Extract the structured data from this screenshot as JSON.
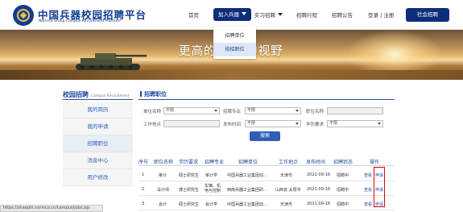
{
  "header": {
    "brand_title": "中国兵器校园招聘平台",
    "brand_subtitle": "Norinco Group Campus Recruitment Platform",
    "nav": {
      "home": "首页",
      "join": "加入兵器",
      "intern": "实习招聘",
      "schedule": "招聘行程",
      "notice": "招聘公告",
      "login_register": "登录 | 注册",
      "social": "社会招聘"
    },
    "dropdown": [
      "招聘单位",
      "校招职位"
    ]
  },
  "hero": {
    "slogan": "更高的 更大的视野"
  },
  "sidebar": {
    "title": "校园招聘",
    "title_en": "Campus Recruitment",
    "items": [
      "我的简历",
      "我的申请",
      "招聘职位",
      "消息中心",
      "用户修改"
    ]
  },
  "main": {
    "title": "招聘职位",
    "filters": {
      "unit_label": "单位名称",
      "unit_value": "不限",
      "major_label": "招聘专业",
      "major_value": "不限",
      "position_label": "职位名称",
      "position_value": "",
      "location_label": "工作地点",
      "location_value": "",
      "time_label": "发布时间",
      "time_value": "不限",
      "degree_label": "学历要求",
      "degree_value": "不限",
      "search_label": "搜索"
    },
    "table": {
      "headers": [
        "序号",
        "职位名称",
        "学历要求",
        "招聘专业",
        "招聘单位",
        "工作地点",
        "发布时间",
        "招聘状态",
        "操作"
      ],
      "rows": [
        {
          "no": "1",
          "title": "审计",
          "degree": "硕士研究生",
          "major": "审计学",
          "unit": "中国兵器工业集团动…",
          "location": "天津市",
          "date": "2021-09-16",
          "status": "招聘中",
          "view": "查看",
          "apply": "申请"
        },
        {
          "no": "2",
          "title": "设计师",
          "degree": "博士研究生",
          "major": "车辆、机电与控制",
          "unit": "西南兵器工业集团研…",
          "location": "山西省 太原市",
          "date": "2021-09-16",
          "status": "招聘中",
          "view": "查看",
          "apply": "申请"
        },
        {
          "no": "3",
          "title": "会计",
          "degree": "硕士研究生",
          "major": "会计学",
          "unit": "中国兵器工业集团动…",
          "location": "天津市",
          "date": "2021-09-16",
          "status": "招聘中",
          "view": "查看",
          "apply": "申请"
        }
      ]
    }
  },
  "status_bar": {
    "url": "https://zhaopin.norinco.cn/campus/jobs.jsp"
  },
  "colors": {
    "brand_blue": "#123d8f",
    "nav_active": "#0f2e7a",
    "link_blue": "#1f4aa0",
    "highlight_red": "#e00000"
  }
}
